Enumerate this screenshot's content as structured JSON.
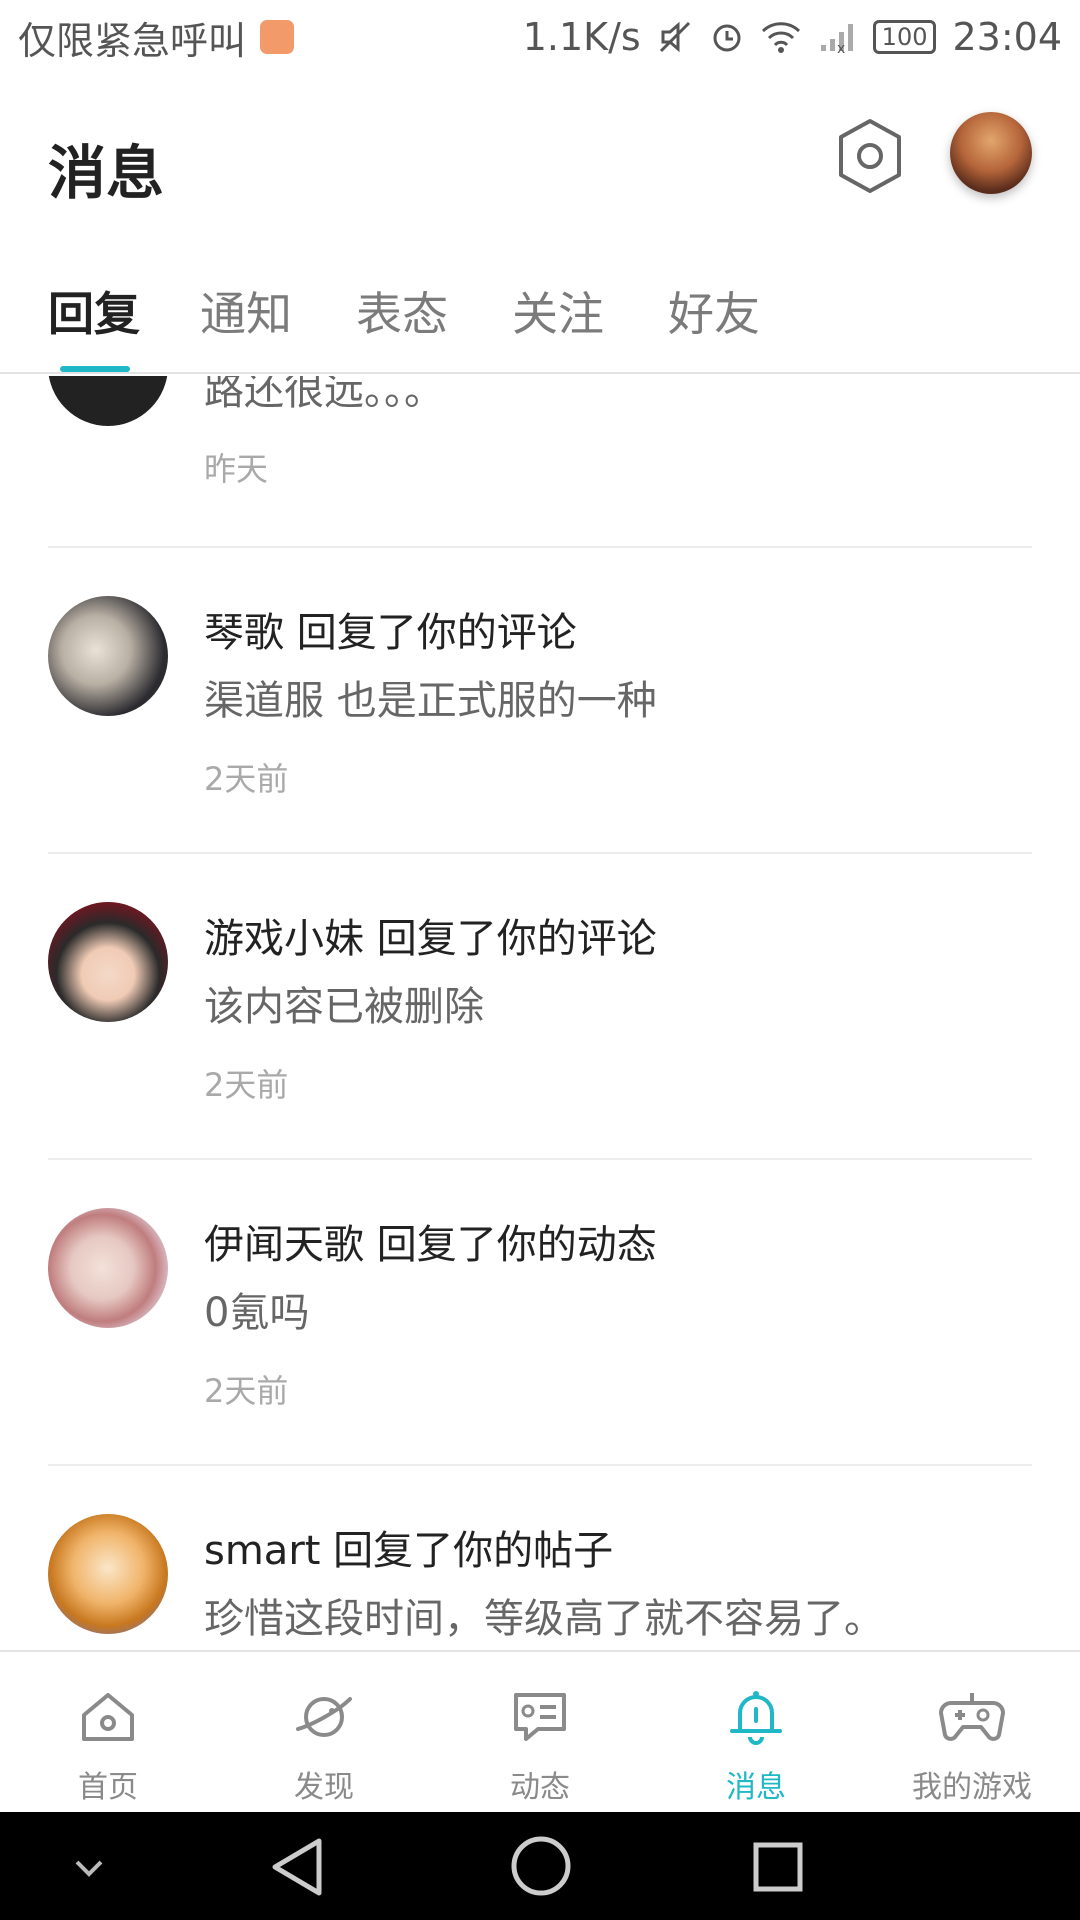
{
  "status_bar": {
    "carrier_text": "仅限紧急呼叫",
    "net_speed": "1.1K/s",
    "battery": "100",
    "time": "23:04"
  },
  "header": {
    "title": "消息"
  },
  "tabs": [
    {
      "label": "回复",
      "active": true
    },
    {
      "label": "通知",
      "active": false
    },
    {
      "label": "表态",
      "active": false
    },
    {
      "label": "关注",
      "active": false
    },
    {
      "label": "好友",
      "active": false
    }
  ],
  "messages": [
    {
      "headline": "",
      "excerpt": "路还很远。。。",
      "time": "昨天"
    },
    {
      "headline": "琴歌 回复了你的评论",
      "excerpt": "渠道服 也是正式服的一种",
      "time": "2天前"
    },
    {
      "headline": "游戏小妹 回复了你的评论",
      "excerpt": "该内容已被删除",
      "time": "2天前"
    },
    {
      "headline": "伊闻天歌 回复了你的动态",
      "excerpt": "0氪吗",
      "time": "2天前"
    },
    {
      "headline": "smart 回复了你的帖子",
      "excerpt": "珍惜这段时间，等级高了就不容易了。",
      "time": ""
    }
  ],
  "bottom_nav": [
    {
      "label": "首页",
      "icon": "home-icon",
      "active": false
    },
    {
      "label": "发现",
      "icon": "planet-icon",
      "active": false
    },
    {
      "label": "动态",
      "icon": "feed-icon",
      "active": false
    },
    {
      "label": "消息",
      "icon": "bell-icon",
      "active": true
    },
    {
      "label": "我的游戏",
      "icon": "gamepad-icon",
      "active": false
    }
  ],
  "colors": {
    "accent": "#20b8c6",
    "text_primary": "#222222",
    "text_secondary": "#666666",
    "text_muted": "#a9a9a9"
  }
}
